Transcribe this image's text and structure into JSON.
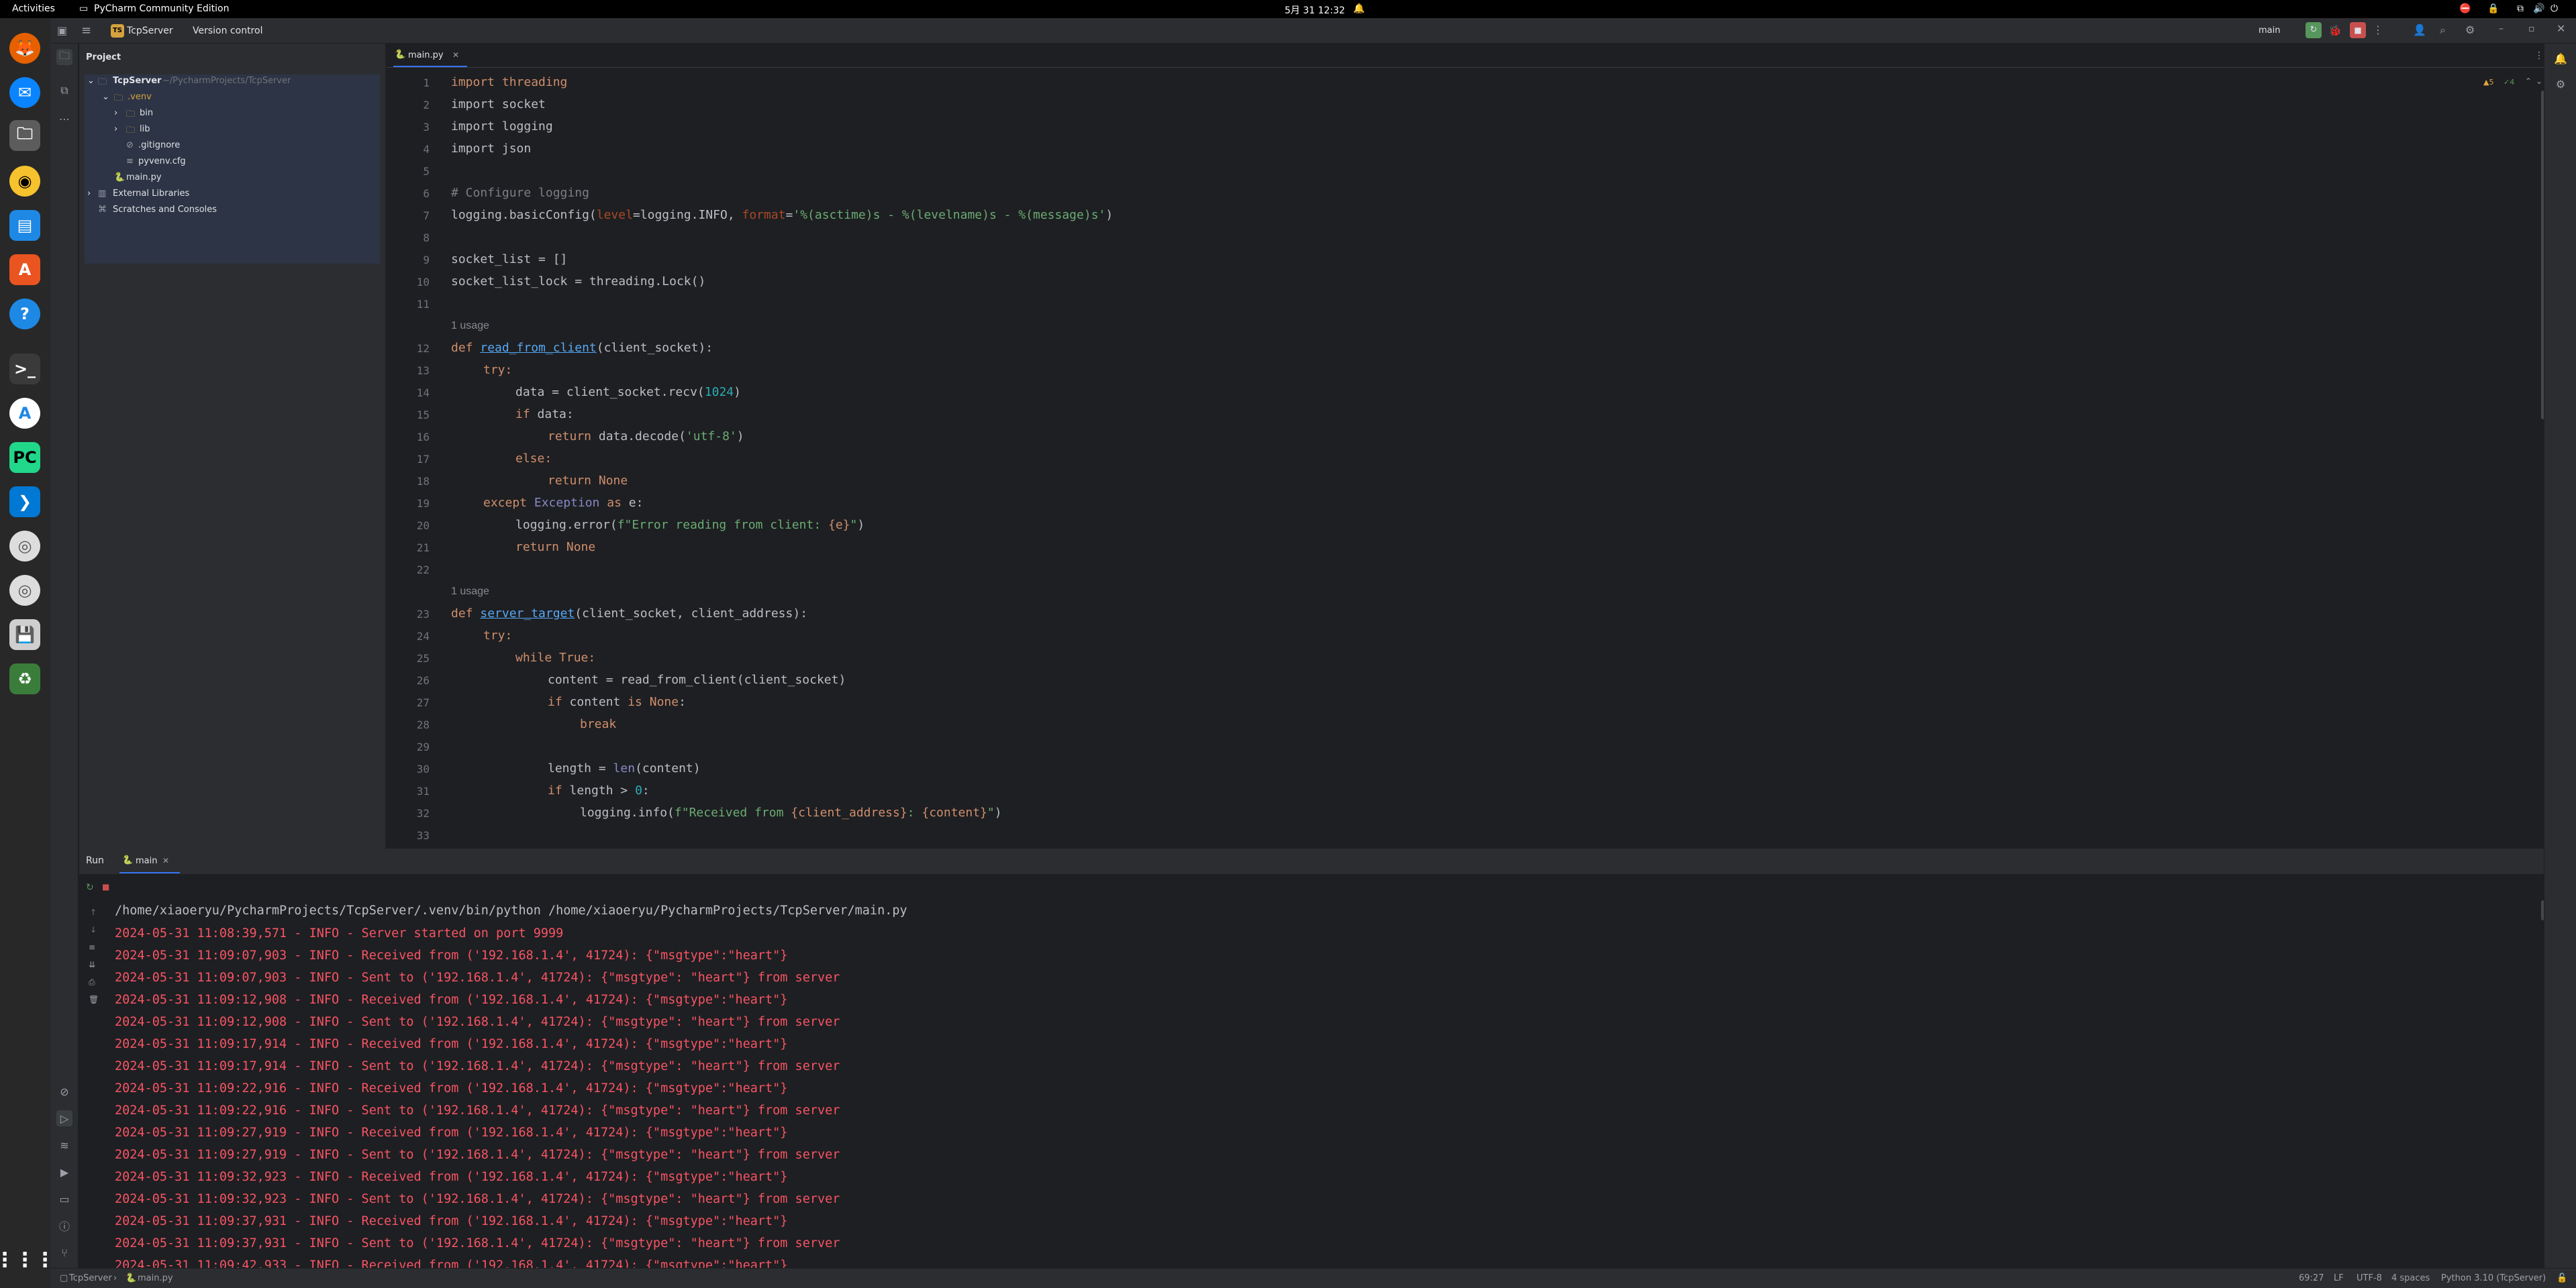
{
  "topbar": {
    "activities": "Activities",
    "app": "PyCharm Community Edition",
    "clock": "5月 31  12:32"
  },
  "dock": {
    "icons": [
      "firefox-icon",
      "thunderbird-icon",
      "files-icon",
      "rhythmbox-icon",
      "writer-icon",
      "appcenter-icon",
      "help-icon",
      "terminal-icon",
      "appstore-icon",
      "pycharm-icon",
      "vscode-icon",
      "disc-icon",
      "disc-icon",
      "save-icon",
      "trash-icon",
      "apps-grid-icon"
    ]
  },
  "header": {
    "project_badge": "TS",
    "project": "TcpServer",
    "vcs": "Version control",
    "run_config": "main"
  },
  "project_panel": {
    "title": "Project",
    "root": "TcpServer",
    "root_path": "~/PycharmProjects/TcpServer",
    "venv": ".venv",
    "bin": "bin",
    "lib": "lib",
    "gitignore": ".gitignore",
    "pyvenv": "pyvenv.cfg",
    "main": "main.py",
    "ext": "External Libraries",
    "scratch": "Scratches and Consoles"
  },
  "editor": {
    "tab": "main.py",
    "warnings": "▲5",
    "weak": "✓4",
    "line_numbers": [
      "1",
      "2",
      "3",
      "4",
      "5",
      "6",
      "7",
      "8",
      "9",
      "10",
      "11",
      "12",
      "13",
      "14",
      "15",
      "16",
      "17",
      "18",
      "19",
      "20",
      "21",
      "22",
      "23",
      "24",
      "25",
      "26",
      "27",
      "28",
      "29",
      "30",
      "31",
      "32",
      "33"
    ],
    "usage1": "1 usage",
    "usage2": "1 usage",
    "c1": "import threading",
    "c2": "import socket",
    "c3": "import logging",
    "c4": "import json",
    "c6": "# Configure logging",
    "c7a": "logging.basicConfig(",
    "c7b": "level",
    "c7c": "=logging.INFO, ",
    "c7d": "format",
    "c7e": "=",
    "c7f": "'%(asctime)s - %(levelname)s - %(message)s'",
    "c7g": ")",
    "c9": "socket_list = []",
    "c10": "socket_list_lock = threading.Lock()",
    "c12a": "def ",
    "c12b": "read_from_client",
    "c12c": "(client_socket):",
    "c13": "try:",
    "c14a": "data = client_socket.recv(",
    "c14b": "1024",
    "c14c": ")",
    "c15a": "if ",
    "c15b": "data:",
    "c16a": "return ",
    "c16b": "data.decode(",
    "c16c": "'utf-8'",
    "c16d": ")",
    "c17": "else:",
    "c18": "return None",
    "c19a": "except ",
    "c19b": "Exception ",
    "c19c": "as ",
    "c19d": "e:",
    "c20a": "logging.error(",
    "c20b": "f\"Error reading from client: ",
    "c20c": "{e}",
    "c20d": "\"",
    ")": ")",
    "c21": "return None",
    "c23a": "def ",
    "c23b": "server_target",
    "c23c": "(client_socket, client_address):",
    "c24": "try:",
    "c25a": "while ",
    "c25b": "True:",
    "c26": "content = read_from_client(client_socket)",
    "c27a": "if ",
    "c27b": "content ",
    "c27c": "is None",
    "c27d": ":",
    "c28": "break",
    "c30a": "length = ",
    "c30b": "len",
    "c30c": "(content)",
    "c31a": "if ",
    "c31b": "length > ",
    "c31c": "0",
    "c31d": ":",
    "c32a": "logging.info(",
    "c32b": "f\"Received from ",
    "c32c": "{client_address}",
    "c32d": ": ",
    "c32e": "{content}",
    "c32f": "\"",
    "c32g": ")"
  },
  "run": {
    "title": "Run",
    "tab": "main",
    "cmd": "/home/xiaoeryu/PycharmProjects/TcpServer/.venv/bin/python /home/xiaoeryu/PycharmProjects/TcpServer/main.py",
    "lines": [
      "2024-05-31 11:08:39,571 - INFO - Server started on port 9999",
      "2024-05-31 11:09:07,903 - INFO - Received from ('192.168.1.4', 41724): {\"msgtype\":\"heart\"}",
      "2024-05-31 11:09:07,903 - INFO - Sent to ('192.168.1.4', 41724): {\"msgtype\": \"heart\"} from server",
      "2024-05-31 11:09:12,908 - INFO - Received from ('192.168.1.4', 41724): {\"msgtype\":\"heart\"}",
      "2024-05-31 11:09:12,908 - INFO - Sent to ('192.168.1.4', 41724): {\"msgtype\": \"heart\"} from server",
      "2024-05-31 11:09:17,914 - INFO - Received from ('192.168.1.4', 41724): {\"msgtype\":\"heart\"}",
      "2024-05-31 11:09:17,914 - INFO - Sent to ('192.168.1.4', 41724): {\"msgtype\": \"heart\"} from server",
      "2024-05-31 11:09:22,916 - INFO - Received from ('192.168.1.4', 41724): {\"msgtype\":\"heart\"}",
      "2024-05-31 11:09:22,916 - INFO - Sent to ('192.168.1.4', 41724): {\"msgtype\": \"heart\"} from server",
      "2024-05-31 11:09:27,919 - INFO - Received from ('192.168.1.4', 41724): {\"msgtype\":\"heart\"}",
      "2024-05-31 11:09:27,919 - INFO - Sent to ('192.168.1.4', 41724): {\"msgtype\": \"heart\"} from server",
      "2024-05-31 11:09:32,923 - INFO - Received from ('192.168.1.4', 41724): {\"msgtype\":\"heart\"}",
      "2024-05-31 11:09:32,923 - INFO - Sent to ('192.168.1.4', 41724): {\"msgtype\": \"heart\"} from server",
      "2024-05-31 11:09:37,931 - INFO - Received from ('192.168.1.4', 41724): {\"msgtype\":\"heart\"}",
      "2024-05-31 11:09:37,931 - INFO - Sent to ('192.168.1.4', 41724): {\"msgtype\": \"heart\"} from server",
      "2024-05-31 11:09:42,933 - INFO - Received from ('192.168.1.4', 41724): {\"msgtype\":\"heart\"}"
    ]
  },
  "status": {
    "crumb_project": "TcpServer",
    "crumb_file": "main.py",
    "position": "69:27",
    "line_sep": "LF",
    "encoding": "UTF-8",
    "indent": "4 spaces",
    "interpreter": "Python 3.10 (TcpServer)"
  }
}
